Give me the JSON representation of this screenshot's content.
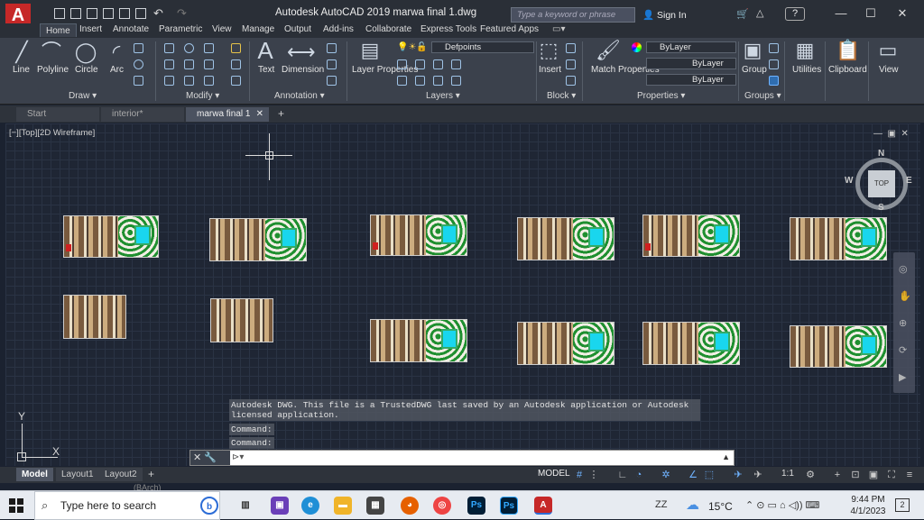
{
  "window": {
    "title": "Autodesk AutoCAD 2019    marwa final 1.dwg",
    "search_placeholder": "Type a keyword or phrase",
    "signin": "Sign In",
    "help": "?"
  },
  "ribbon_tabs": [
    "Home",
    "Insert",
    "Annotate",
    "Parametric",
    "View",
    "Manage",
    "Output",
    "Add-ins",
    "Collaborate",
    "Express Tools",
    "Featured Apps"
  ],
  "ribbon": {
    "draw": {
      "title": "Draw",
      "line": "Line",
      "polyline": "Polyline",
      "circle": "Circle",
      "arc": "Arc"
    },
    "modify": {
      "title": "Modify"
    },
    "annotation": {
      "title": "Annotation",
      "text": "Text",
      "dimension": "Dimension"
    },
    "layers": {
      "title": "Layers",
      "layer_properties": "Layer Properties",
      "current_layer": "Defpoints"
    },
    "block": {
      "title": "Block",
      "insert": "Insert"
    },
    "properties": {
      "title": "Properties",
      "match_properties": "Match Properties",
      "color": "ByLayer",
      "linetype": "ByLayer",
      "lineweight": "ByLayer"
    },
    "groups": {
      "title": "Groups",
      "group": "Group"
    },
    "utilities": "Utilities",
    "clipboard": "Clipboard",
    "view": "View"
  },
  "file_tabs": [
    {
      "label": "Start",
      "active": false
    },
    {
      "label": "interior*",
      "active": false
    },
    {
      "label": "marwa final 1",
      "active": true
    }
  ],
  "viewport_label": "[−][Top][2D Wireframe]",
  "viewcube": {
    "face": "TOP",
    "n": "N",
    "s": "S",
    "e": "E",
    "w": "W"
  },
  "ucs": {
    "x": "X",
    "y": "Y"
  },
  "command": {
    "history": "Autodesk DWG.  This file is a TrustedDWG last saved by an Autodesk application or Autodesk licensed application.",
    "line1": "Command:",
    "line2": "Command:",
    "input_value": ""
  },
  "layout_tabs": [
    {
      "label": "Model",
      "active": true
    },
    {
      "label": "Layout1",
      "active": false
    },
    {
      "label": "Layout2",
      "active": false
    }
  ],
  "status": {
    "model": "MODEL",
    "scale": "1:1"
  },
  "taskbar": {
    "search_placeholder": "Type here to search",
    "temperature": "15°C",
    "time": "9:44 PM",
    "date": "4/1/2023",
    "notification_count": "2",
    "bg_fragment": "(BArch)"
  }
}
